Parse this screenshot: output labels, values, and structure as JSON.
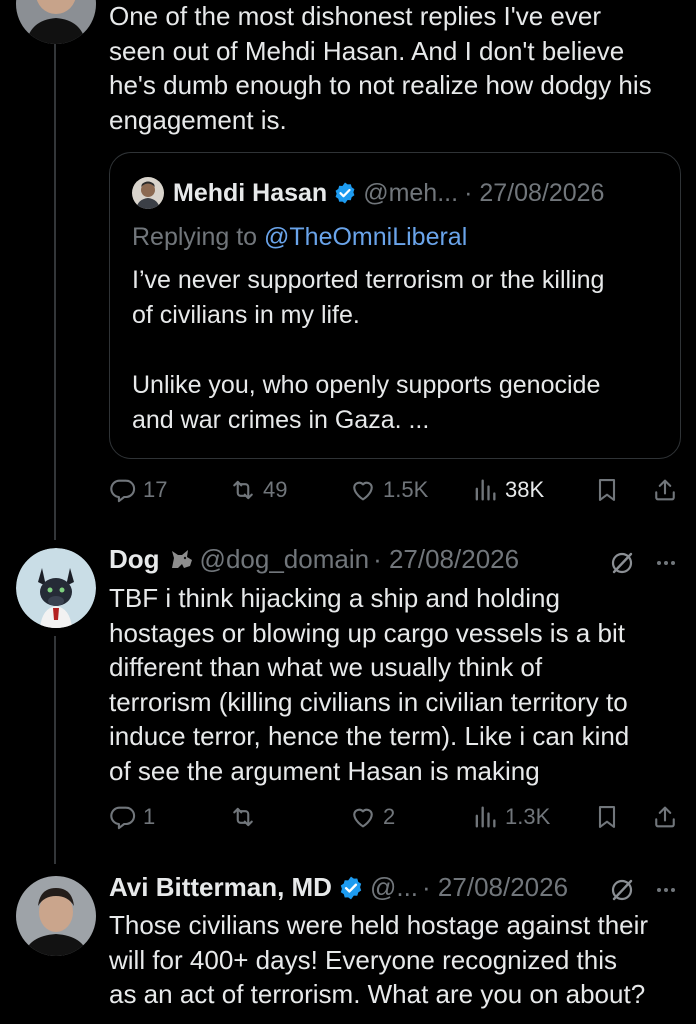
{
  "tweets": [
    {
      "text": "One of the most dishonest replies I've ever\nseen out of Mehdi Hasan. And I don't believe\nhe's dumb enough to not realize how dodgy his\nengagement is.",
      "quote": {
        "name": "Mehdi Hasan",
        "handle": "@meh...",
        "date": "· 27/08/2026",
        "replying_prefix": "Replying to ",
        "replying_to": "@TheOmniLiberal",
        "text": "I’ve never supported terrorism or the killing\nof civilians in my life.\n\nUnlike you, who openly supports genocide\nand war crimes in Gaza. ..."
      },
      "actions": {
        "replies": "17",
        "reposts": "49",
        "likes": "1.5K",
        "views": "38K"
      }
    },
    {
      "name": "Dog",
      "handle": "@dog_domain",
      "date": "· 27/08/2026",
      "text": "TBF i think hijacking a ship and holding\nhostages or blowing up cargo vessels is a bit\ndifferent than what we usually think of\nterrorism (killing civilians in civilian territory to\ninduce terror, hence the term). Like i can kind\nof see the argument Hasan is making",
      "actions": {
        "replies": "1",
        "reposts": "",
        "likes": "2",
        "views": "1.3K"
      }
    },
    {
      "name": "Avi Bitterman, MD",
      "handle": "@...",
      "date": "· 27/08/2026",
      "text": "Those civilians were held hostage against their\nwill for 400+ days! Everyone recognized this\nas an act of terrorism. What are you on about?"
    }
  ],
  "colors": {
    "background": "#000000",
    "text": "#e7e9ea",
    "muted": "#71767b",
    "link": "#6aa4ea",
    "verified": "#1d9bf0",
    "border": "#2f3336"
  },
  "icons": [
    "reply-icon",
    "repost-icon",
    "like-icon",
    "views-icon",
    "bookmark-icon",
    "share-icon",
    "verified-badge-icon",
    "grok-icon",
    "more-icon",
    "dog-emoji-icon"
  ]
}
